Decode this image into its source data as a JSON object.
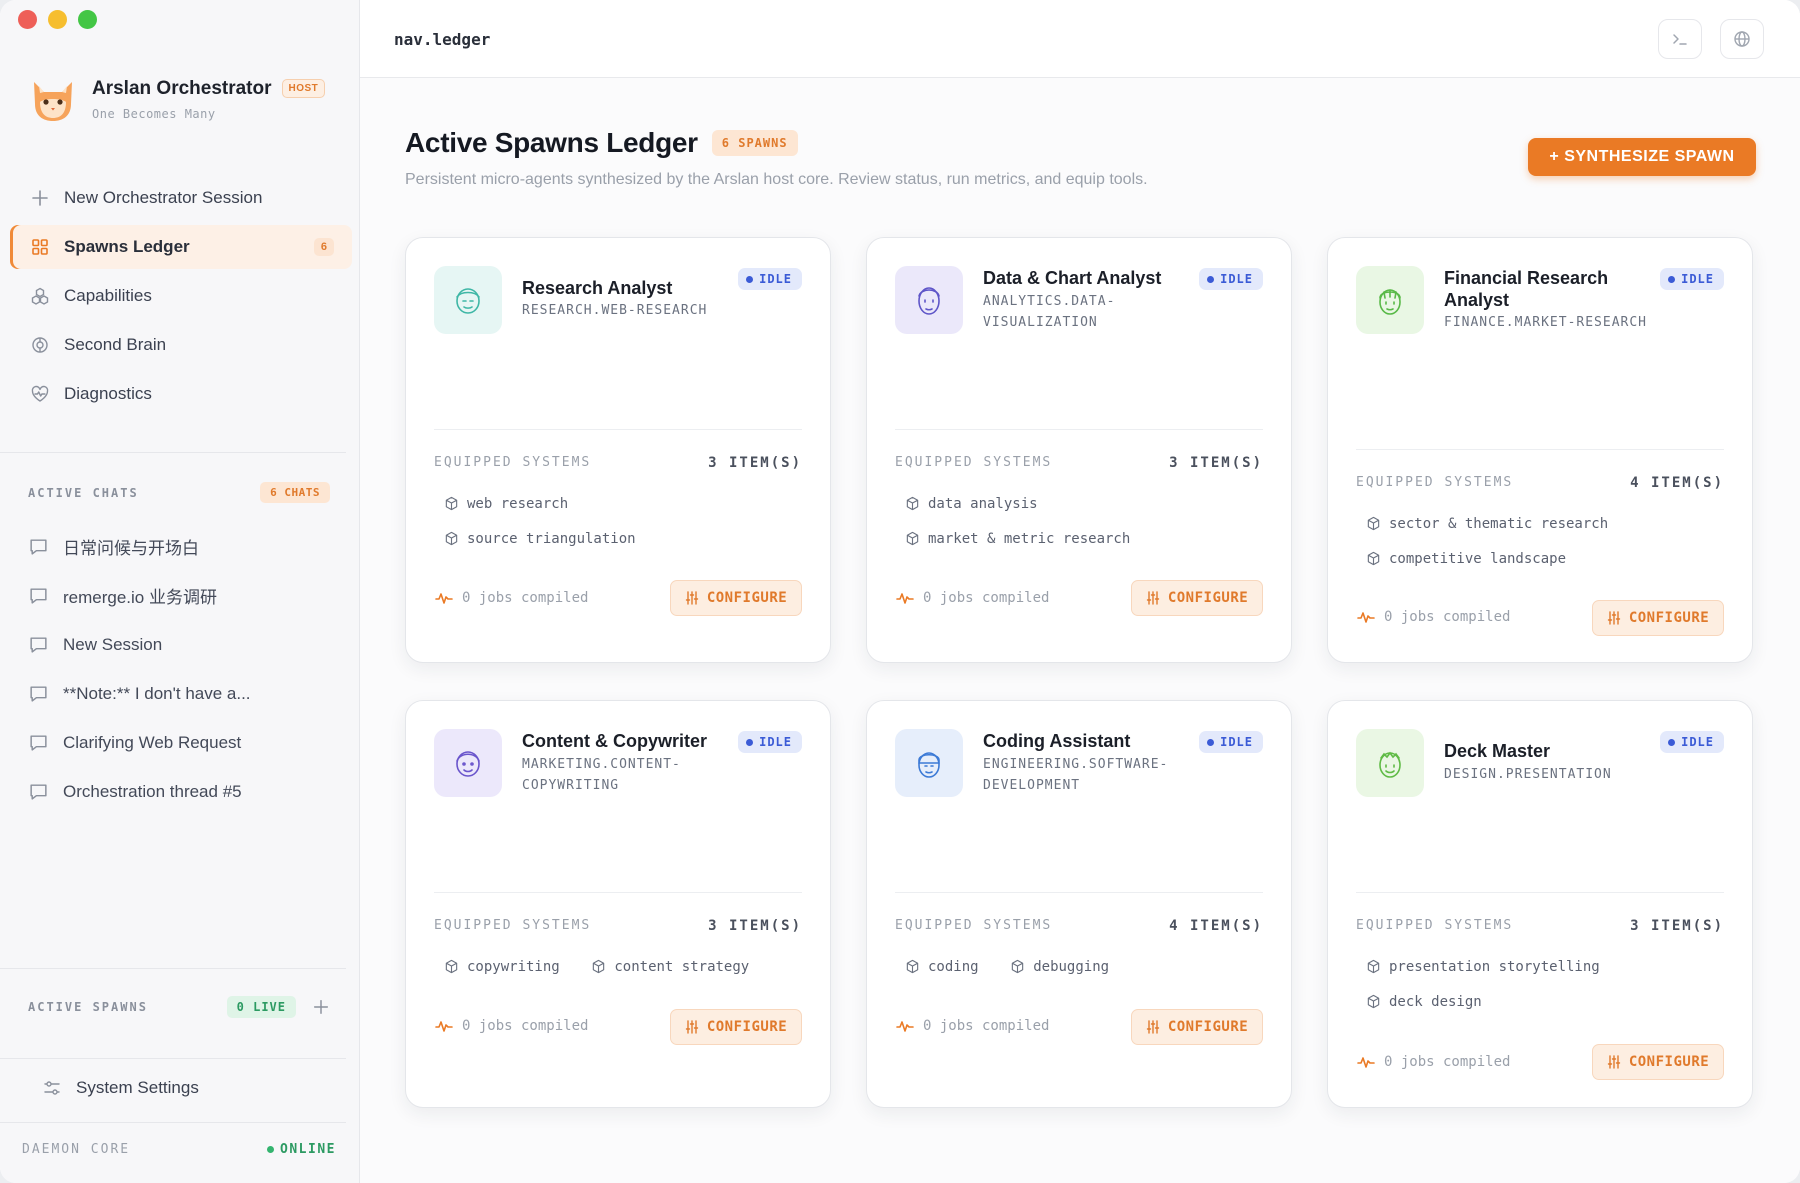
{
  "topbar": {
    "breadcrumb": "nav.ledger"
  },
  "brand": {
    "title": "Arslan Orchestrator",
    "badge": "HOST",
    "subtitle": "One Becomes Many"
  },
  "nav": [
    {
      "label": "New Orchestrator Session",
      "icon": "plus-icon"
    },
    {
      "label": "Spawns Ledger",
      "icon": "grid-icon",
      "count": "6",
      "active": true
    },
    {
      "label": "Capabilities",
      "icon": "cubes-icon"
    },
    {
      "label": "Second Brain",
      "icon": "brain-icon"
    },
    {
      "label": "Diagnostics",
      "icon": "heart-pulse-icon"
    }
  ],
  "active_chats": {
    "label": "ACTIVE CHATS",
    "count": "6 CHATS",
    "items": [
      "日常问候与开场白",
      "remerge.io 业务调研",
      "New Session",
      "**Note:** I don't have a...",
      "Clarifying Web Request",
      "Orchestration thread #5"
    ]
  },
  "active_spawns": {
    "label": "ACTIVE SPAWNS",
    "count": "0 LIVE"
  },
  "settings": {
    "label": "System Settings"
  },
  "daemon": {
    "label": "DAEMON CORE",
    "status": "ONLINE"
  },
  "page": {
    "title": "Active Spawns Ledger",
    "count_chip": "6 SPAWNS",
    "subtitle": "Persistent micro-agents synthesized by the Arslan host core. Review status, run metrics, and equip tools.",
    "cta": "+ SYNTHESIZE SPAWN"
  },
  "card_labels": {
    "status": "IDLE",
    "equipped": "EQUIPPED SYSTEMS",
    "jobs": "0 jobs compiled",
    "configure": "CONFIGURE"
  },
  "cards": [
    {
      "name": "Research Analyst",
      "role": "RESEARCH.WEB-RESEARCH",
      "count": "3 ITEM(S)",
      "tools": [
        "web research",
        "source triangulation"
      ],
      "avatar_bg": "#e6f6f4",
      "avatar_fg": "#3fb7a6"
    },
    {
      "name": "Data & Chart Analyst",
      "role": "ANALYTICS.DATA-VISUALIZATION",
      "count": "3 ITEM(S)",
      "tools": [
        "data analysis",
        "market & metric research"
      ],
      "avatar_bg": "#ebe8fa",
      "avatar_fg": "#5e55c8"
    },
    {
      "name": "Financial Research Analyst",
      "role": "FINANCE.MARKET-RESEARCH",
      "count": "4 ITEM(S)",
      "tools": [
        "sector & thematic research",
        "competitive landscape"
      ],
      "avatar_bg": "#e9f7e4",
      "avatar_fg": "#58b947"
    },
    {
      "name": "Content & Copywriter",
      "role": "MARKETING.CONTENT-COPYWRITING",
      "count": "3 ITEM(S)",
      "tools": [
        "copywriting",
        "content strategy"
      ],
      "avatar_bg": "#ece8fb",
      "avatar_fg": "#6a55cc"
    },
    {
      "name": "Coding Assistant",
      "role": "ENGINEERING.SOFTWARE-DEVELOPMENT",
      "count": "4 ITEM(S)",
      "tools": [
        "coding",
        "debugging"
      ],
      "avatar_bg": "#e6eefb",
      "avatar_fg": "#3c7ad6"
    },
    {
      "name": "Deck Master",
      "role": "DESIGN.PRESENTATION",
      "count": "3 ITEM(S)",
      "tools": [
        "presentation storytelling",
        "deck design"
      ],
      "avatar_bg": "#eaf7e4",
      "avatar_fg": "#5fbb45"
    }
  ]
}
